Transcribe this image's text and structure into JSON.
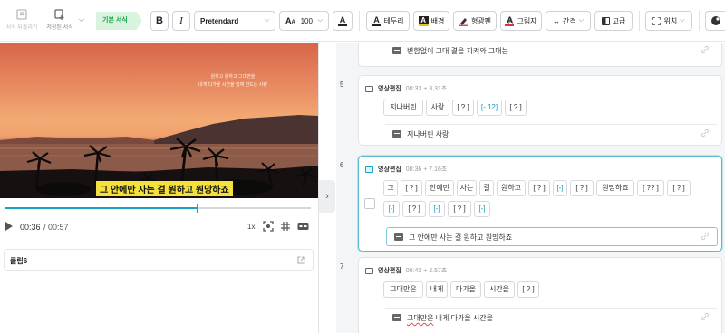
{
  "toolbar": {
    "undo_style_label": "서식 되돌리기",
    "saved_style_label": "저장된 서식",
    "style_tag": "기본 서식",
    "bold": "B",
    "italic": "I",
    "font_family": "Pretendard",
    "size_glyph": "A",
    "font_size": "100",
    "font_color_glyph": "A",
    "border_label": "테두리",
    "background_label": "배경",
    "highlighter_label": "형광펜",
    "shadow_label": "그림자",
    "spacing_label": "간격",
    "advanced_label": "고급",
    "position_label": "위치"
  },
  "video": {
    "overlay_line1": "원하고 원하고 그대만을",
    "overlay_line2": "내게 다가올 시간을 함께 만드는 사랑",
    "subtitle": "그 안에만 사는 걸 원하고 원망하죠",
    "progress": 0.63,
    "time_current": "00:36",
    "time_total": "/ 00:57",
    "speed": "1x",
    "clip_name": "클립6"
  },
  "list": {
    "card_prev_text": "변함없이 그대 곁을 지켜와 그대는",
    "cards": [
      {
        "num": "5",
        "tag": "영상편집",
        "time": "00:33 + 3.31초",
        "tokens": [
          "지나버린",
          "사랑",
          "[ ? ]",
          "[- 12]",
          "[ ? ]"
        ],
        "text": "지나버린 사랑"
      },
      {
        "num": "6",
        "tag": "영상편집",
        "time": "00:36 + 7.16초",
        "tokens_row1": [
          "그",
          "[ ? ]",
          "안에만",
          "사는",
          "걸",
          "원하고",
          "[ ? ]",
          "[-]",
          "[ ? ]",
          "원망하죠",
          "[ ?? ]",
          "[ ? ]"
        ],
        "tokens_row2": [
          "[-]",
          "[ ? ]",
          "[-]",
          "[ ? ]",
          "[-]"
        ],
        "text": "그 안에만 사는 걸 원하고 원망하죠"
      },
      {
        "num": "7",
        "tag": "영상편집",
        "time": "00:43 + 2.57초",
        "tokens": [
          "그대만은",
          "내게",
          "다가올",
          "시간을",
          "[ ? ]"
        ],
        "text_underlined": "그대만은",
        "text_rest": " 내게 다가올 시간을"
      }
    ]
  },
  "colors": {
    "accent": "#1aa3c9",
    "style_tag_bg": "#d8f3de",
    "style_tag_fg": "#19a24a",
    "subtitle_bg": "#f5e13c",
    "active_border": "#58bcd4"
  }
}
